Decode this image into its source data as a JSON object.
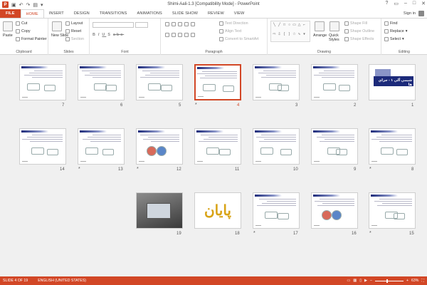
{
  "window": {
    "title": "Shimi-Aali-1.3 [Compatibility Mode] - PowerPoint",
    "controls": [
      "?",
      "▭",
      "–",
      "□",
      "✕"
    ]
  },
  "quick_access": {
    "app_letter": "P"
  },
  "tabs": [
    "FILE",
    "HOME",
    "INSERT",
    "DESIGN",
    "TRANSITIONS",
    "ANIMATIONS",
    "SLIDE SHOW",
    "REVIEW",
    "VIEW"
  ],
  "active_tab": "HOME",
  "sign_in": "Sign in",
  "ribbon": {
    "clipboard": {
      "label": "Clipboard",
      "paste": "Paste",
      "cut": "Cut",
      "copy": "Copy",
      "format_painter": "Format Painter"
    },
    "slides": {
      "label": "Slides",
      "new_slide": "New Slide",
      "layout": "Layout",
      "reset": "Reset",
      "section": "Section"
    },
    "font": {
      "label": "Font"
    },
    "paragraph": {
      "label": "Paragraph",
      "text_direction": "Text Direction",
      "align_text": "Align Text",
      "convert": "Convert to SmartArt"
    },
    "drawing": {
      "label": "Drawing",
      "arrange": "Arrange",
      "quick_styles": "Quick Styles",
      "shape_fill": "Shape Fill",
      "shape_outline": "Shape Outline",
      "shape_effects": "Shape Effects"
    },
    "editing": {
      "label": "Editing",
      "find": "Find",
      "replace": "Replace",
      "select": "Select"
    }
  },
  "slides": [
    {
      "n": "1",
      "star": ""
    },
    {
      "n": "2",
      "star": ""
    },
    {
      "n": "3",
      "star": ""
    },
    {
      "n": "4",
      "star": "*",
      "selected": true
    },
    {
      "n": "5",
      "star": ""
    },
    {
      "n": "6",
      "star": ""
    },
    {
      "n": "7",
      "star": ""
    },
    {
      "n": "8",
      "star": "*"
    },
    {
      "n": "9",
      "star": ""
    },
    {
      "n": "10",
      "star": ""
    },
    {
      "n": "11",
      "star": ""
    },
    {
      "n": "12",
      "star": "*"
    },
    {
      "n": "13",
      "star": "*"
    },
    {
      "n": "14",
      "star": ""
    },
    {
      "n": "15",
      "star": "*"
    },
    {
      "n": "16",
      "star": ""
    },
    {
      "n": "17",
      "star": "*"
    },
    {
      "n": "18",
      "star": ""
    },
    {
      "n": "19",
      "star": ""
    }
  ],
  "slide1_title": "شيمي آلي ١ - جزاي ها",
  "slide18_text": "پايان",
  "status": {
    "slide_info": "SLIDE 4 OF 19",
    "language": "ENGLISH (UNITED STATES)",
    "zoom": "63%",
    "zoom_level_percent": 63
  },
  "colors": {
    "accent": "#d24726",
    "slide_header": "#1c2a7a"
  }
}
